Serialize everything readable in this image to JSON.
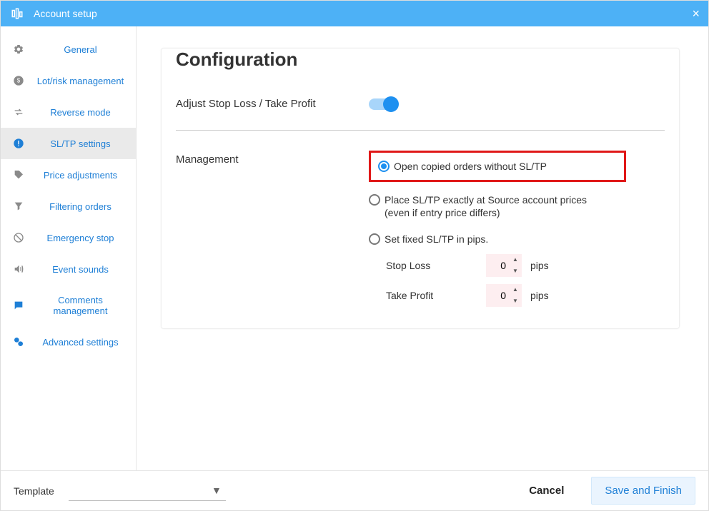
{
  "titlebar": {
    "title": "Account setup"
  },
  "sidebar": {
    "items": [
      {
        "label": "General"
      },
      {
        "label": "Lot/risk management"
      },
      {
        "label": "Reverse mode"
      },
      {
        "label": "SL/TP settings"
      },
      {
        "label": "Price adjustments"
      },
      {
        "label": "Filtering orders"
      },
      {
        "label": "Emergency stop"
      },
      {
        "label": "Event sounds"
      },
      {
        "label": "Comments management"
      },
      {
        "label": "Advanced settings"
      }
    ]
  },
  "page": {
    "heading": "Configuration",
    "adjust_label": "Adjust Stop Loss / Take Profit",
    "adjust_on": true,
    "management_label": "Management",
    "options": {
      "opt1": "Open copied orders without SL/TP",
      "opt2": "Place SL/TP exactly at Source account prices (even if entry price differs)",
      "opt3": "Set fixed SL/TP in pips."
    },
    "stoploss_label": "Stop Loss",
    "stoploss_value": "0",
    "takeprofit_label": "Take Profit",
    "takeprofit_value": "0",
    "unit": "pips"
  },
  "footer": {
    "template_label": "Template",
    "cancel": "Cancel",
    "save": "Save and Finish"
  }
}
